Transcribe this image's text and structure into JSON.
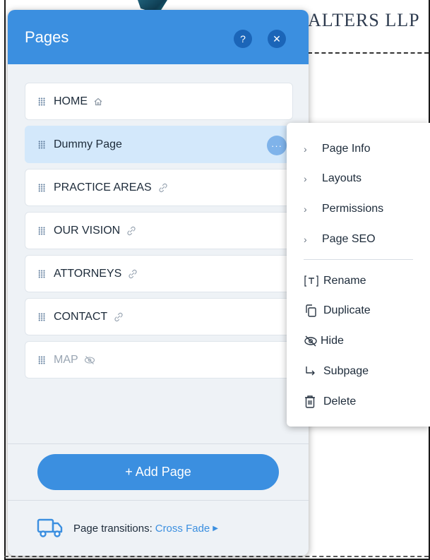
{
  "site": {
    "heading": "ALTERS LLP"
  },
  "panel": {
    "title": "Pages",
    "help_label": "?",
    "close_label": "✕",
    "pages": [
      {
        "label": "HOME",
        "icon": "home-icon"
      },
      {
        "label": "Dummy Page",
        "icon": "more-icon",
        "selected": true
      },
      {
        "label": "PRACTICE AREAS",
        "icon": "link-icon"
      },
      {
        "label": "OUR VISION",
        "icon": "link-icon"
      },
      {
        "label": "ATTORNEYS",
        "icon": "link-icon"
      },
      {
        "label": "CONTACT",
        "icon": "link-icon"
      },
      {
        "label": "MAP",
        "icon": "hidden-eye-icon",
        "hidden": true
      }
    ],
    "more_label": "···",
    "add_page_label": "+ Add Page",
    "transitions_label": "Page transitions:",
    "transitions_value": "Cross Fade"
  },
  "context_menu": {
    "submenus": [
      "Page Info",
      "Layouts",
      "Permissions",
      "Page SEO"
    ],
    "actions": [
      {
        "label": "Rename",
        "icon": "rename-icon"
      },
      {
        "label": "Duplicate",
        "icon": "duplicate-icon"
      },
      {
        "label": "Hide",
        "icon": "hide-icon"
      },
      {
        "label": "Subpage",
        "icon": "subpage-icon"
      },
      {
        "label": "Delete",
        "icon": "trash-icon"
      }
    ]
  },
  "colors": {
    "accent": "#3b8fe0",
    "selected_row": "#d3e8fb",
    "panel_bg": "#eef2f6"
  }
}
